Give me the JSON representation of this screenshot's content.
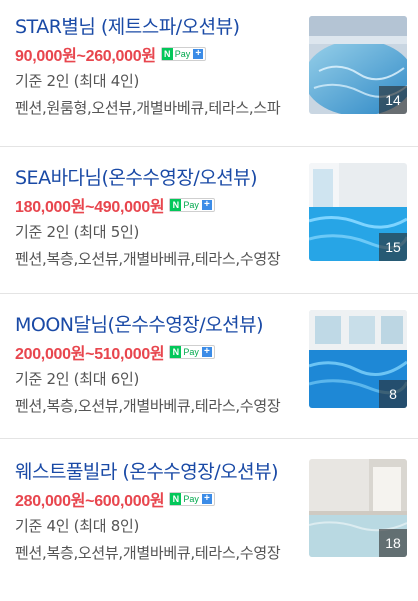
{
  "listings": [
    {
      "name": "STAR별님 (제트스파/오션뷰)",
      "price": "90,000원~260,000원",
      "npay_n": "N",
      "npay_label": "Pay",
      "npay_plus": "+",
      "capacity": "기준 2인 (최대 4인)",
      "tags": "펜션,원룸형,오션뷰,개별바베큐,테라스,스파",
      "photo_count": "14"
    },
    {
      "name": "SEA바다님(온수수영장/오션뷰)",
      "price": "180,000원~490,000원",
      "npay_n": "N",
      "npay_label": "Pay",
      "npay_plus": "+",
      "capacity": "기준 2인 (최대 5인)",
      "tags": "펜션,복층,오션뷰,개별바베큐,테라스,수영장",
      "photo_count": "15"
    },
    {
      "name": "MOON달님(온수수영장/오션뷰)",
      "price": "200,000원~510,000원",
      "npay_n": "N",
      "npay_label": "Pay",
      "npay_plus": "+",
      "capacity": "기준 2인 (최대 6인)",
      "tags": "펜션,복층,오션뷰,개별바베큐,테라스,수영장",
      "photo_count": "8"
    },
    {
      "name": "웨스트풀빌라 (온수수영장/오션뷰)",
      "price": "280,000원~600,000원",
      "npay_n": "N",
      "npay_label": "Pay",
      "npay_plus": "+",
      "capacity": "기준 4인 (최대 8인)",
      "tags": "펜션,복층,오션뷰,개별바베큐,테라스,수영장",
      "photo_count": "18"
    }
  ],
  "colors": {
    "name": "#1a4aa6",
    "price": "#e8464e",
    "npay_green": "#03c75a",
    "npay_plus": "#3c8ce7"
  },
  "icons": [
    "naver-pay-icon",
    "plus-icon"
  ]
}
